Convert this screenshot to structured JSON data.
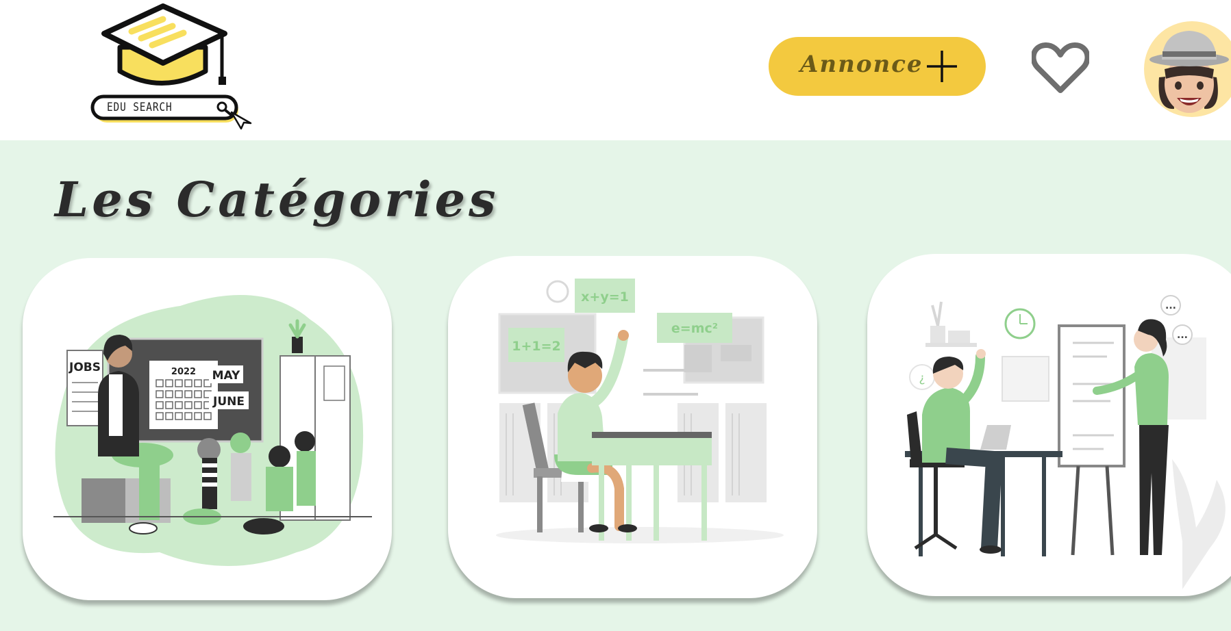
{
  "header": {
    "logo": {
      "text": "EDU SEARCH",
      "icon": "graduation-cap-icon"
    },
    "annonce_button": {
      "label": "Annonce",
      "icon": "plus-icon"
    },
    "favorites_icon": "heart-icon",
    "avatar_icon": "memoji-avatar"
  },
  "main": {
    "title": "Les Catégories",
    "categories": [
      {
        "illustration": "teacher-with-children",
        "texts": {
          "jobs": "JOBS",
          "year": "2022",
          "month1": "MAY",
          "month2": "JUNE"
        }
      },
      {
        "illustration": "student-raising-hand",
        "texts": {
          "eq1": "x+y=1",
          "eq2": "1+1=2",
          "eq3": "e=mc²"
        }
      },
      {
        "illustration": "presenter-at-whiteboard",
        "texts": {
          "q": "¿",
          "bubble1": "...",
          "bubble2": "..."
        }
      }
    ]
  },
  "colors": {
    "accent_yellow": "#f3c93f",
    "background_green": "#e5f5e8",
    "illustration_green": "#8fcf8c",
    "dark": "#2b2b2b"
  }
}
